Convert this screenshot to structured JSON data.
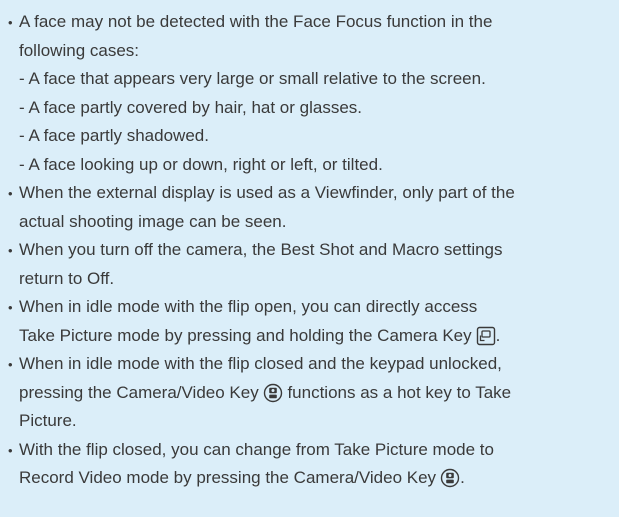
{
  "bullets": [
    {
      "lines": [
        "A face may not be detected with the Face Focus function in the",
        "following cases:"
      ],
      "sub_items": [
        "- A face that appears very large or small relative to the screen.",
        "- A face partly covered by hair, hat or glasses.",
        "- A face partly shadowed.",
        "- A face looking up or down, right or left, or tilted."
      ]
    },
    {
      "lines": [
        "When the external display is used as a Viewfinder, only part of the",
        "actual shooting image can be seen."
      ]
    },
    {
      "lines": [
        "When you turn off the camera, the Best Shot and Macro settings",
        "return to Off."
      ]
    },
    {
      "lines": [
        "When in idle mode with the flip open, you can directly access",
        "Take Picture mode by pressing and holding the Camera Key",
        "."
      ],
      "icon": "camera-key-icon"
    },
    {
      "lines": [
        "When in idle mode with the flip closed and the keypad unlocked,",
        "pressing the Camera/Video Key",
        "functions as a hot key to Take",
        "Picture."
      ],
      "icon": "camera-video-key-icon"
    },
    {
      "lines": [
        "With the flip closed, you can change from Take Picture mode to",
        "Record Video mode by pressing the Camera/Video Key",
        "."
      ],
      "icon": "camera-video-key-icon"
    }
  ],
  "bullet_char": "•",
  "colors": {
    "background": "#dbeef9",
    "text": "#3a3a3a"
  }
}
